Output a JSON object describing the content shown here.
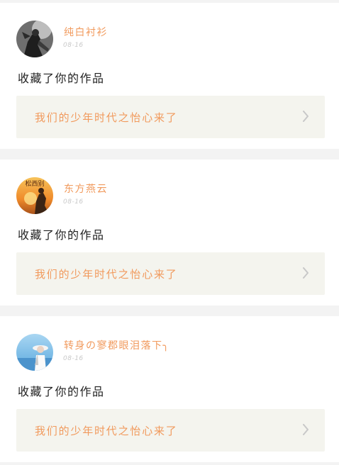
{
  "colors": {
    "accent": "#f19a5d",
    "date": "#c9c9c9",
    "page_background": "#f3f3f3",
    "work_background": "#f4f4ee",
    "chevron": "#c8c8c8"
  },
  "feed": [
    {
      "username": "纯白衬衫",
      "date": "08-16",
      "action": "收藏了你的作品",
      "work_title": "我们的少年时代之怡心来了",
      "avatar_icon": "avatar-dark-warrior-icon",
      "chevron_icon": "chevron-right-icon"
    },
    {
      "username": "东方燕云",
      "date": "08-16",
      "action": "收藏了你的作品",
      "work_title": "我们的少年时代之怡心来了",
      "avatar_icon": "avatar-sunset-rider-icon",
      "avatar_logo_text": "松西别",
      "chevron_icon": "chevron-right-icon"
    },
    {
      "username": "转身の寥郡眼泪落下╮",
      "date": "08-16",
      "action": "收藏了你的作品",
      "work_title": "我们的少年时代之怡心来了",
      "avatar_icon": "avatar-girl-sky-icon",
      "chevron_icon": "chevron-right-icon"
    }
  ]
}
